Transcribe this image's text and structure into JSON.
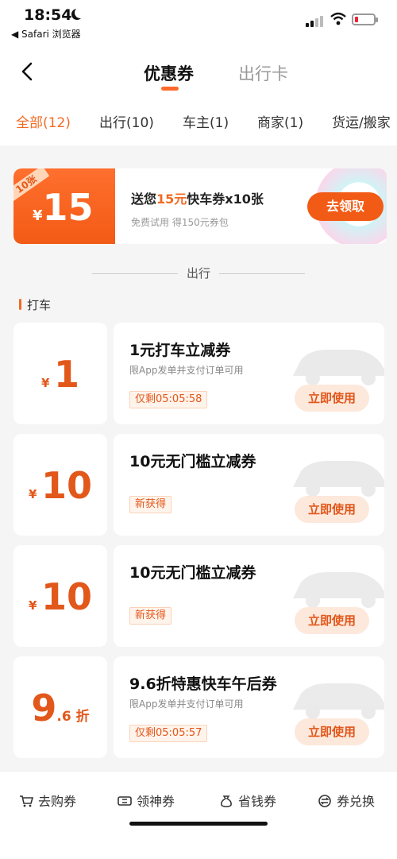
{
  "status": {
    "time": "18:54",
    "back_app": "◀ Safari 浏览器"
  },
  "nav": {
    "tabs": [
      "优惠券",
      "出行卡"
    ]
  },
  "filters": [
    "全部(12)",
    "出行(10)",
    "车主(1)",
    "商家(1)",
    "货运/搬家"
  ],
  "banner": {
    "ribbon": "10张",
    "yen": "¥",
    "amount": "15",
    "title_pre": "送您",
    "title_hl": "15元",
    "title_post": "快车券x10张",
    "subtitle": "免费试用 得150元券包",
    "button": "去领取"
  },
  "section": {
    "title": "出行",
    "group": "打车"
  },
  "coupons": [
    {
      "yen": "¥",
      "amount": "1",
      "suffix": "",
      "title": "1元打车立减券",
      "desc": "限App发单并支付订单可用",
      "tag": "仅剩05:05:58",
      "button": "立即使用"
    },
    {
      "yen": "¥",
      "amount": "10",
      "suffix": "",
      "title": "10元无门槛立减券",
      "desc": "",
      "tag": "新获得",
      "button": "立即使用"
    },
    {
      "yen": "¥",
      "amount": "10",
      "suffix": "",
      "title": "10元无门槛立减券",
      "desc": "",
      "tag": "新获得",
      "button": "立即使用"
    },
    {
      "yen": "",
      "amount": "9",
      "suffix": ".6 折",
      "title": "9.6折特惠快车午后券",
      "desc": "限App发单并支付订单可用",
      "tag": "仅剩05:05:57",
      "button": "立即使用"
    }
  ],
  "tabbar": [
    "去购券",
    "领神券",
    "省钱券",
    "券兑换"
  ],
  "colors": {
    "accent": "#f26a22",
    "button": "#f25b15"
  }
}
